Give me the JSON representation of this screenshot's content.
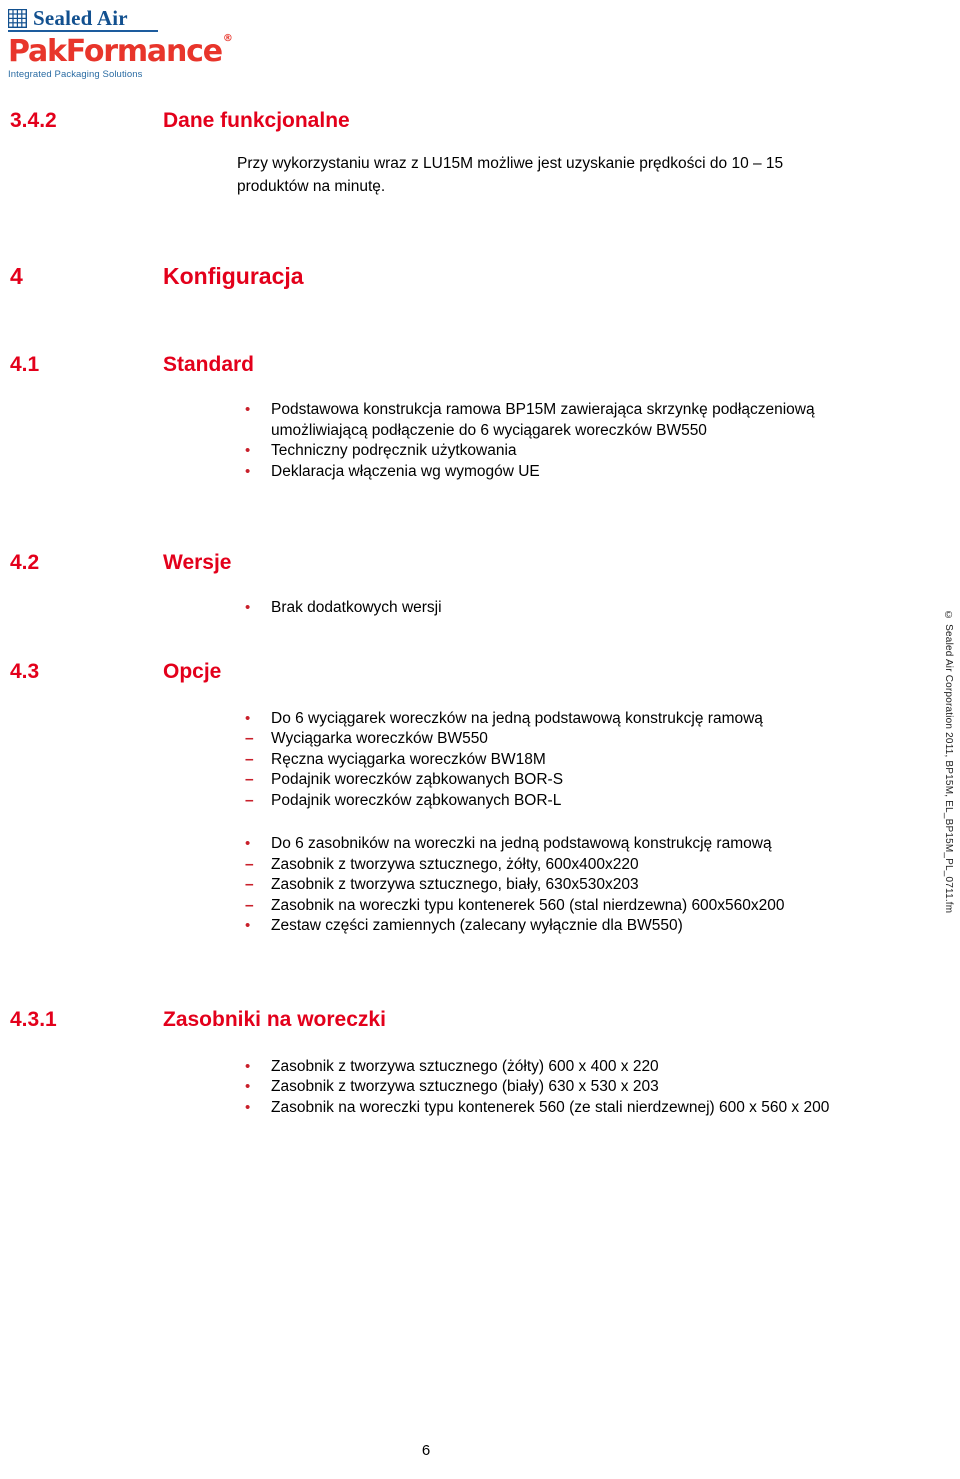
{
  "logo": {
    "brand_primary": "Sealed Air",
    "brand_secondary": "PakFormance",
    "registered_mark": "®",
    "tagline": "Integrated Packaging Solutions",
    "colors": {
      "sealed_air_blue": "#12508f",
      "pakformance_red": "#e8352b",
      "tagline_blue": "#2b6ca3",
      "heading_red": "#e3001b",
      "bullet_red": "#c9202b"
    },
    "icons": {
      "grid": "grid-icon"
    }
  },
  "sections": {
    "dane_funkcjonalne": {
      "number": "3.4.2",
      "title": "Dane funkcjonalne",
      "paragraph": "Przy wykorzystaniu wraz z LU15M możliwe jest uzyskanie prędkości do 10 – 15 produktów na minutę."
    },
    "konfiguracja": {
      "number": "4",
      "title": "Konfiguracja"
    },
    "standard": {
      "number": "4.1",
      "title": "Standard",
      "bullets": [
        "Podstawowa konstrukcja ramowa BP15M zawierająca skrzynkę podłączeniową umożliwiającą podłączenie do 6 wyciągarek woreczków BW550",
        "Techniczny podręcznik użytkowania",
        "Deklaracja włączenia wg wymogów UE"
      ]
    },
    "wersje": {
      "number": "4.2",
      "title": "Wersje",
      "bullets": [
        "Brak dodatkowych wersji"
      ]
    },
    "opcje": {
      "number": "4.3",
      "title": "Opcje",
      "group_one": {
        "bullet": "Do 6 wyciągarek woreczków na jedną podstawową konstrukcję ramową",
        "sub_items": [
          "Wyciągarka woreczków BW550",
          "Ręczna wyciągarka woreczków BW18M",
          "Podajnik woreczków ząbkowanych BOR-S",
          "Podajnik woreczków ząbkowanych BOR-L"
        ]
      },
      "group_two": {
        "bullet": "Do 6 zasobników na woreczki na jedną podstawową konstrukcję ramową",
        "sub_items": [
          "Zasobnik z tworzywa sztucznego, żółty, 600x400x220",
          "Zasobnik z tworzywa sztucznego, biały, 630x530x203",
          "Zasobnik na woreczki typu kontenerek 560 (stal nierdzewna) 600x560x200"
        ]
      },
      "final_bullet": "Zestaw części zamiennych (zalecany wyłącznie dla BW550)"
    },
    "zasobniki": {
      "number": "4.3.1",
      "title": "Zasobniki na woreczki",
      "bullets": [
        "Zasobnik z tworzywa sztucznego (żółty) 600 x 400 x 220",
        "Zasobnik z tworzywa sztucznego (biały) 630 x 530 x 203",
        "Zasobnik na woreczki typu kontenerek 560 (ze stali nierdzewnej) 600 x 560 x 200"
      ]
    }
  },
  "side_note": "© Sealed Air Corporation 2011, BP15M, EL_BP15M_PL_0711.fm",
  "footer": {
    "page_number": "6"
  },
  "glyphs": {
    "bullet_dot": "•",
    "dash": "–"
  }
}
